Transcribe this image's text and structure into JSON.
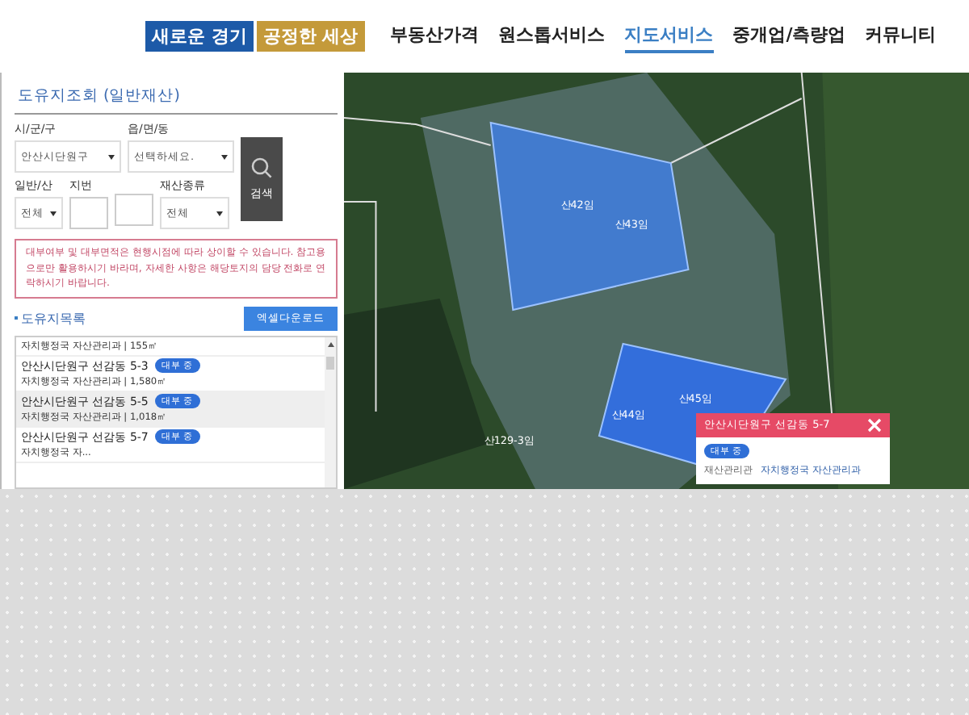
{
  "header": {
    "logo": [
      "새로운 경기",
      "공정한 세상"
    ],
    "nav": [
      {
        "label": "부동산가격",
        "selected": false
      },
      {
        "label": "원스톱서비스",
        "selected": false
      },
      {
        "label": "지도서비스",
        "selected": true
      },
      {
        "label": "중개업/측량업",
        "selected": false
      },
      {
        "label": "커뮤니티",
        "selected": false
      }
    ]
  },
  "panel": {
    "title": "도유지조회 (일반재산)",
    "filters_row1": [
      {
        "label": "시/군/구",
        "value": "안산시단원구"
      },
      {
        "label": "읍/면/동",
        "value": "선택하세요."
      }
    ],
    "filters_row2": [
      {
        "kind": "select",
        "label": "일반/산",
        "value": "전체"
      },
      {
        "kind": "input",
        "label": "지번"
      },
      {
        "kind": "input"
      },
      {
        "kind": "select",
        "label": "재산종류",
        "value": "전체"
      }
    ],
    "search_button": "검색",
    "notice": "대부여부 및 대부면적은 현행시점에 따라 상이할 수 있습니다. 참고용으로만 활용하시기 바라며, 자세한 사항은 해당토지의 담당 전화로 연락하시기 바랍니다.",
    "list_title": "도유지목록",
    "excel_button": "엑셀다운로드",
    "list": [
      {
        "detail": "자치행정국 자산관리과 | 155㎡",
        "selected": false
      },
      {
        "address": "안산시단원구 선감동 5-3",
        "badge": "대부 중",
        "detail": "자치행정국 자산관리과 | 1,580㎡",
        "selected": false
      },
      {
        "address": "안산시단원구 선감동 5-5",
        "badge": "대부 중",
        "detail": "자치행정국 자산관리과 | 1,018㎡",
        "selected": true
      },
      {
        "address": "안산시단원구 선감동 5-7",
        "badge": "대부 중",
        "detail": "자치행정국 자...",
        "selected": false
      }
    ]
  },
  "map": {
    "labels": [
      {
        "text": "산42임"
      },
      {
        "text": "산43임"
      },
      {
        "text": "산129-3임"
      },
      {
        "text": "산44임"
      },
      {
        "text": "산45임"
      }
    ],
    "popup": {
      "title": "안산시단원구 선감동 5-7",
      "badge": "대부 중",
      "field_label": "재산관리관",
      "field_value": "자치행정국 자산관리과"
    }
  }
}
